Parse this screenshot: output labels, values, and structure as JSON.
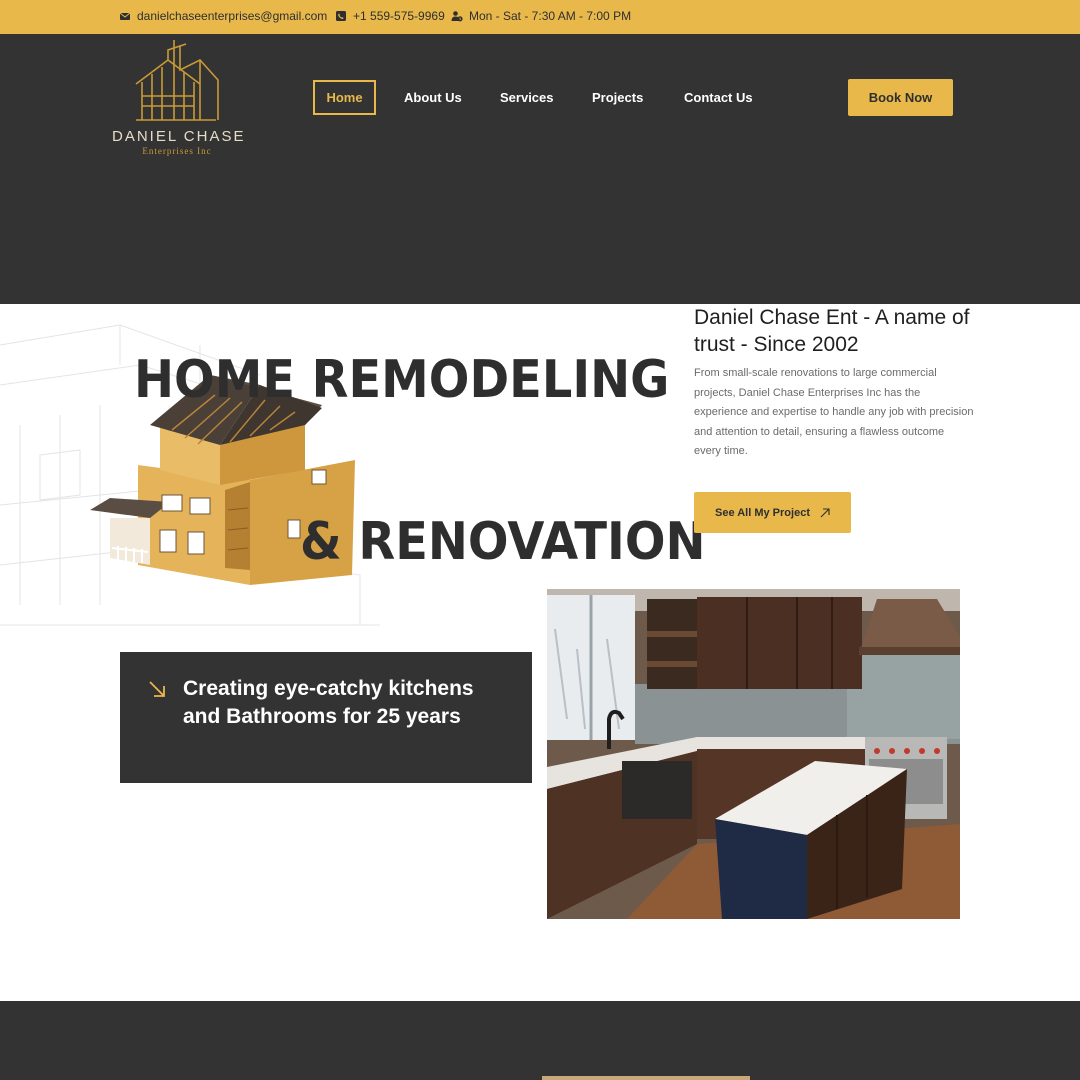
{
  "topbar": {
    "email": "danielchaseenterprises@gmail.com",
    "phone": "+1 559-575-9969",
    "hours": "Mon - Sat - 7:30 AM - 7:00 PM",
    "icons": [
      "envelope-icon",
      "phone-icon",
      "user-clock-icon"
    ]
  },
  "logo": {
    "name": "DANIEL CHASE",
    "sub": "Enterprises Inc"
  },
  "nav": {
    "items": [
      "Home",
      "About Us",
      "Services",
      "Projects",
      "Contact Us"
    ],
    "active": "Home",
    "book_label": "Book Now"
  },
  "hero": {
    "line1": "HOME REMODELING",
    "line2": "& RENOVATION"
  },
  "trust": {
    "title": "Daniel Chase Ent - A name of trust - Since 2002",
    "body": "From small-scale renovations to large commercial projects, Daniel Chase Enterprises Inc has the experience and expertise to handle any job with precision and attention to detail, ensuring a flawless outcome every time.",
    "button_label": "See All My Project"
  },
  "feature": {
    "text": "Creating eye-catchy kitchens and Bathrooms for 25 years"
  },
  "colors": {
    "accent": "#e8b84b",
    "dark": "#333333",
    "text": "#2e2e2e",
    "muted": "#6b6b6b"
  }
}
